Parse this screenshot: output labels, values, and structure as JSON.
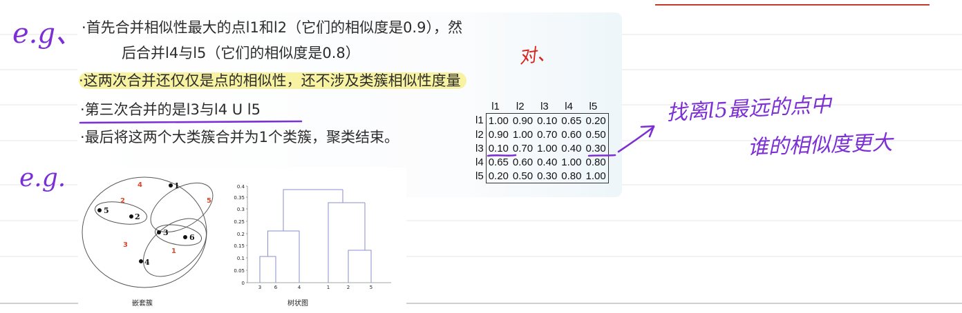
{
  "slide": {
    "bullets": [
      {
        "prefix": "·",
        "text": "首先合并相似性最大的点l1和l2（它们的相似度是0.9），然"
      },
      {
        "prefix": "",
        "text": "后合并l4与l5（它们的相似度是0.8）"
      },
      {
        "prefix": "·",
        "text": "这两次合并还仅仅是点的相似性，还不涉及类簇相似性度量"
      },
      {
        "prefix": "·",
        "text": "第三次合并的是l3与l4 U l5"
      },
      {
        "prefix": "·",
        "text": "最后将这两个大类簇合并为1个类簇，聚类结束。"
      }
    ],
    "highlight_color": "#f8f2a3"
  },
  "similarity_table": {
    "columns": [
      "l1",
      "l2",
      "l3",
      "l4",
      "l5"
    ],
    "rows": [
      {
        "label": "l1",
        "values": [
          "1.00",
          "0.90",
          "0.10",
          "0.65",
          "0.20"
        ]
      },
      {
        "label": "l2",
        "values": [
          "0.90",
          "1.00",
          "0.70",
          "0.60",
          "0.50"
        ]
      },
      {
        "label": "l3",
        "values": [
          "0.10",
          "0.70",
          "1.00",
          "0.40",
          "0.30"
        ]
      },
      {
        "label": "l4",
        "values": [
          "0.65",
          "0.60",
          "0.40",
          "1.00",
          "0.80"
        ]
      },
      {
        "label": "l5",
        "values": [
          "0.20",
          "0.50",
          "0.30",
          "0.80",
          "1.00"
        ]
      }
    ]
  },
  "nested_figure": {
    "caption": "嵌套簇",
    "points": [
      "1",
      "2",
      "3",
      "4",
      "5",
      "6"
    ],
    "cluster_order_labels": [
      "1",
      "2",
      "3",
      "4",
      "5"
    ]
  },
  "dendrogram": {
    "caption": "树状图",
    "y_ticks": [
      "0",
      "0.05",
      "0.1",
      "0.15",
      "0.2",
      "0.25",
      "0.3",
      "0.35",
      "0.4"
    ],
    "x_leaves": [
      "3",
      "6",
      "4",
      "1",
      "2",
      "5"
    ]
  },
  "handwriting": {
    "eg_top": "e.g、",
    "eg_bottom": "e.g.",
    "mark": "对、",
    "note_line1": "找离l5最远的点中",
    "note_line2": "谁的相似度更大"
  },
  "colors": {
    "ink_purple": "#7b2fd4",
    "ink_red": "#d8241c",
    "accent_red_line": "#c0392b",
    "ruled_line": "#e6e6e6",
    "dendro_line": "#8a8ed0",
    "cluster_red": "#d64a2c"
  }
}
